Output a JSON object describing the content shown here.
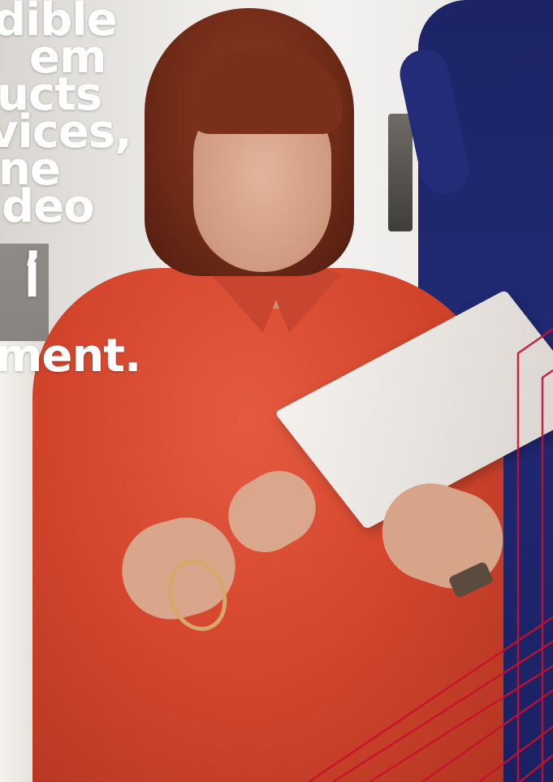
{
  "headline_fragments": [
    "dible",
    "em",
    "ucts",
    "vices,",
    "ne",
    "deo",
    ",",
    "l",
    "",
    "ment."
  ],
  "colors": {
    "accent_red": "#c8102e",
    "text": "#ffffff",
    "shirt": "#d3452c",
    "dress_navy": "#1e2670"
  },
  "decor": {
    "type": "diagonal-red-lines"
  }
}
